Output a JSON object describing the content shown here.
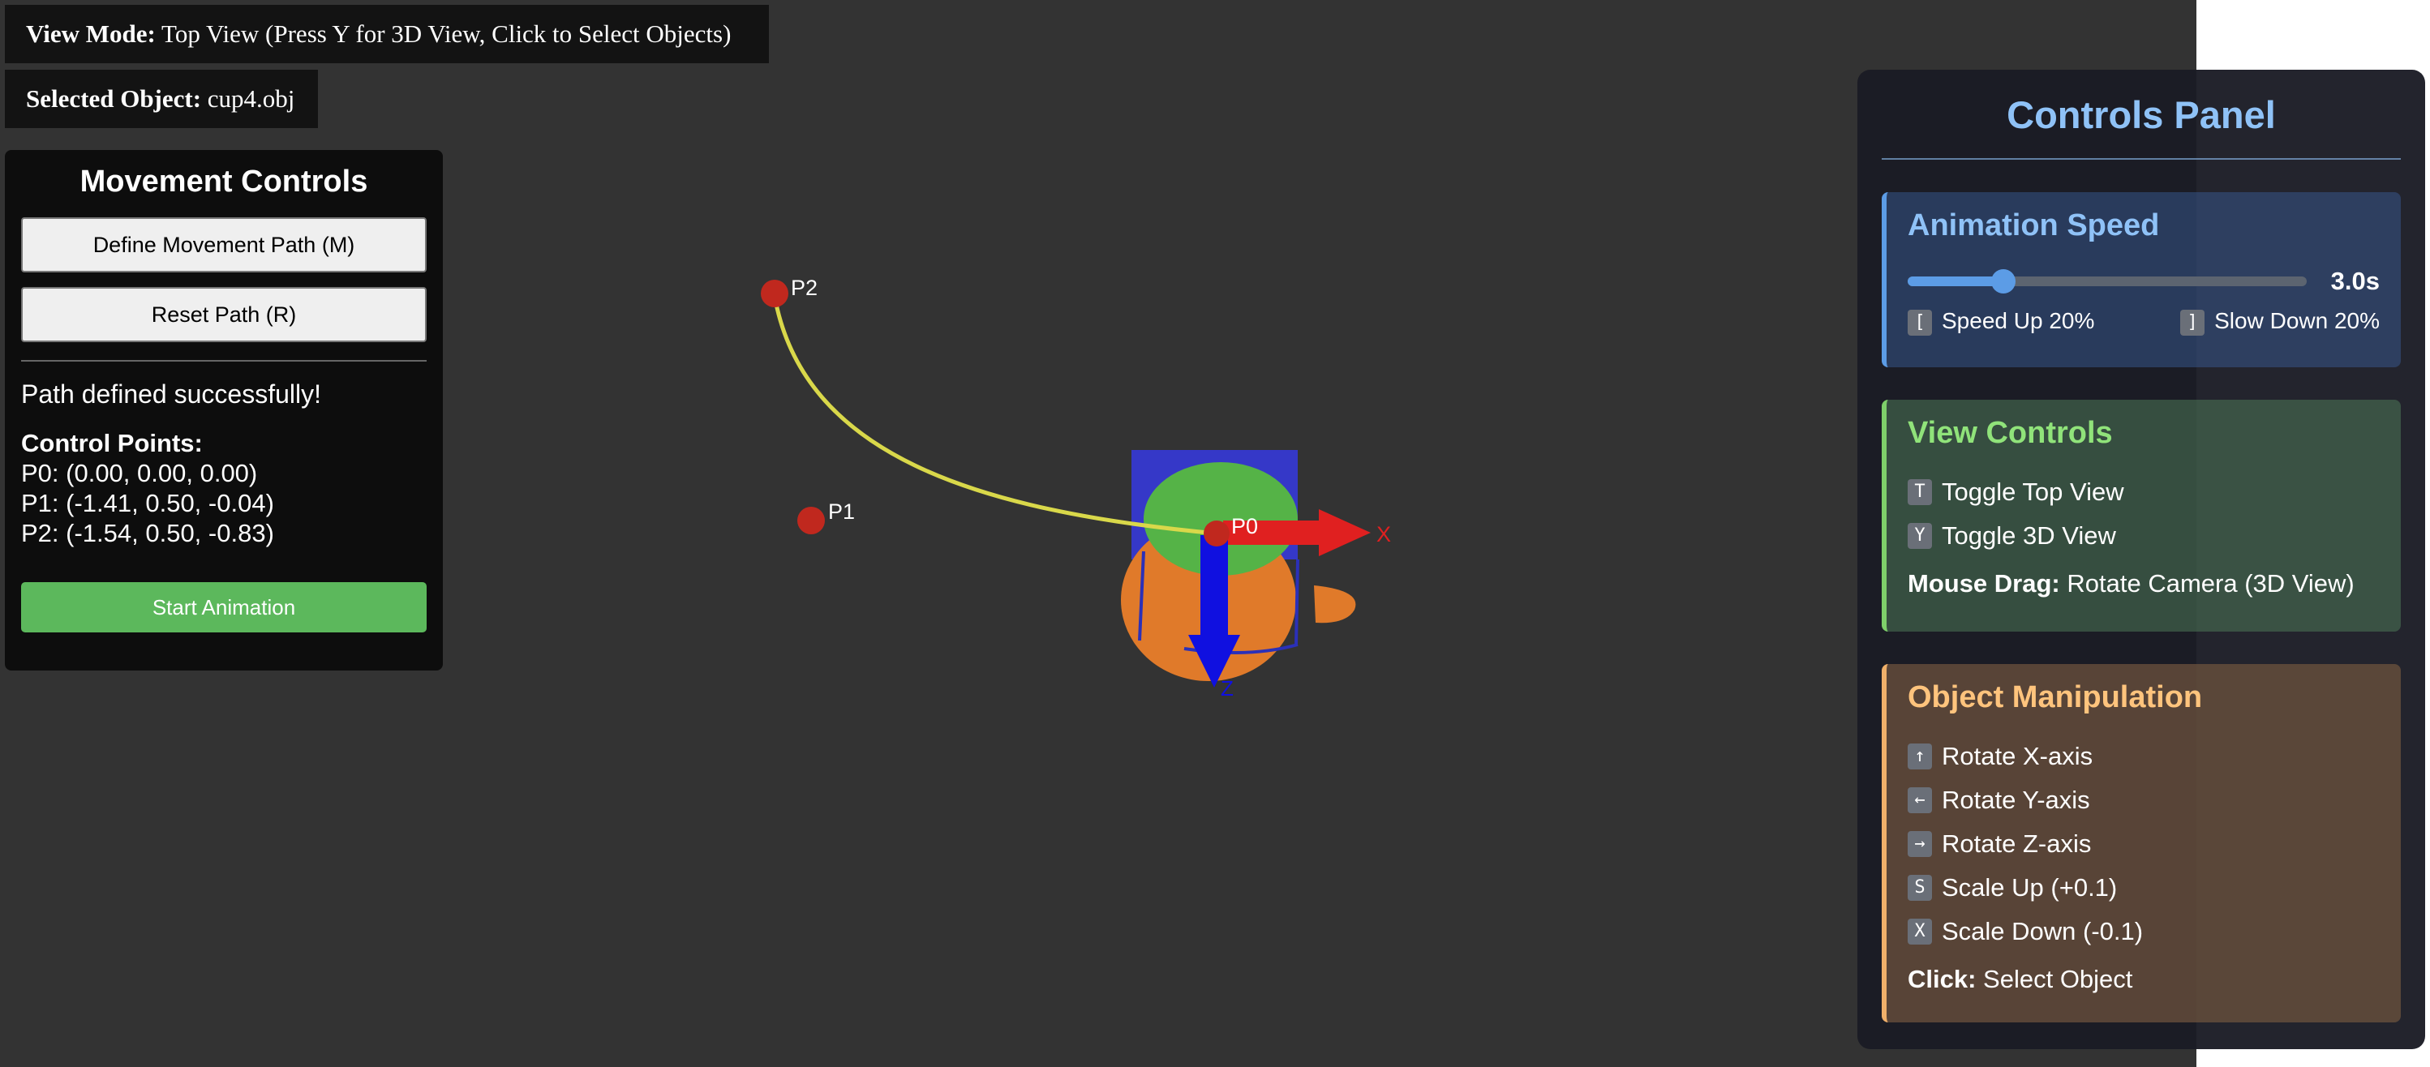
{
  "info": {
    "view_mode_label": "View Mode:",
    "view_mode_value": "Top View (Press Y for 3D View, Click to Select Objects)",
    "selected_label": "Selected Object:",
    "selected_value": "cup4.obj"
  },
  "movement": {
    "title": "Movement Controls",
    "define_button": "Define Movement Path (M)",
    "reset_button": "Reset Path (R)",
    "status": "Path defined successfully!",
    "points_title": "Control Points:",
    "points": [
      "P0: (0.00, 0.00, 0.00)",
      "P1: (-1.41, 0.50, -0.04)",
      "P2: (-1.54, 0.50, -0.83)"
    ],
    "start_button": "Start Animation"
  },
  "scene": {
    "point_labels": [
      "P0",
      "P1",
      "P2"
    ],
    "axis_x_label": "X",
    "axis_z_label": "Z",
    "colors": {
      "background": "#333333",
      "path": "#d9d84a",
      "control_point": "#c0281e",
      "cup_body": "#e07a2a",
      "cup_top": "#55b347",
      "cup_box": "#3538c8",
      "axis_x": "#e02020",
      "axis_z": "#1010e0"
    }
  },
  "panel": {
    "title": "Controls Panel",
    "speed": {
      "title": "Animation Speed",
      "value": "3.0s",
      "slider_fraction": 0.24,
      "up_key": "[",
      "up_label": "Speed Up 20%",
      "down_key": "]",
      "down_label": "Slow Down 20%"
    },
    "view": {
      "title": "View Controls",
      "items": [
        {
          "key": "T",
          "label": "Toggle Top View"
        },
        {
          "key": "Y",
          "label": "Toggle 3D View"
        }
      ],
      "note_label": "Mouse Drag:",
      "note_value": "Rotate Camera (3D View)"
    },
    "object": {
      "title": "Object Manipulation",
      "items": [
        {
          "key": "↑",
          "label": "Rotate X-axis"
        },
        {
          "key": "←",
          "label": "Rotate Y-axis"
        },
        {
          "key": "→",
          "label": "Rotate Z-axis"
        },
        {
          "key": "S",
          "label": "Scale Up (+0.1)"
        },
        {
          "key": "X",
          "label": "Scale Down (-0.1)"
        }
      ],
      "note_label": "Click:",
      "note_value": "Select Object"
    }
  }
}
